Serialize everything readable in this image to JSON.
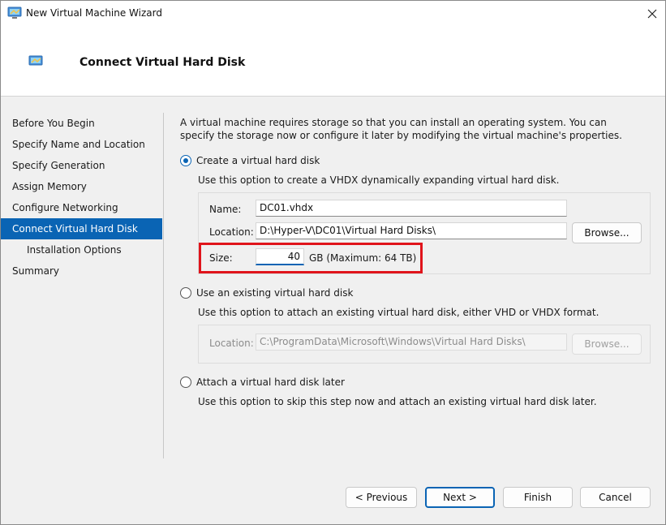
{
  "window": {
    "title": "New Virtual Machine Wizard"
  },
  "header": {
    "page_title": "Connect Virtual Hard Disk"
  },
  "sidebar": {
    "items": [
      {
        "label": "Before You Begin"
      },
      {
        "label": "Specify Name and Location"
      },
      {
        "label": "Specify Generation"
      },
      {
        "label": "Assign Memory"
      },
      {
        "label": "Configure Networking"
      },
      {
        "label": "Connect Virtual Hard Disk",
        "active": true
      },
      {
        "label": "Installation Options"
      },
      {
        "label": "Summary"
      }
    ]
  },
  "main": {
    "intro": "A virtual machine requires storage so that you can install an operating system. You can specify the storage now or configure it later by modifying the virtual machine's properties.",
    "create_option": {
      "label": "Create a virtual hard disk",
      "selected": true,
      "description": "Use this option to create a VHDX dynamically expanding virtual hard disk.",
      "name_label": "Name:",
      "name_value": "DC01.vhdx",
      "location_label": "Location:",
      "location_value": "D:\\Hyper-V\\DC01\\Virtual Hard Disks\\",
      "browse_label": "Browse...",
      "size_label": "Size:",
      "size_value": "40",
      "size_unit": "GB (Maximum: 64 TB)"
    },
    "existing_option": {
      "label": "Use an existing virtual hard disk",
      "selected": false,
      "description": "Use this option to attach an existing virtual hard disk, either VHD or VHDX format.",
      "location_label": "Location:",
      "location_value": "C:\\ProgramData\\Microsoft\\Windows\\Virtual Hard Disks\\",
      "browse_label": "Browse..."
    },
    "later_option": {
      "label": "Attach a virtual hard disk later",
      "selected": false,
      "description": "Use this option to skip this step now and attach an existing virtual hard disk later."
    }
  },
  "footer": {
    "previous_label": "< Previous",
    "next_label": "Next >",
    "finish_label": "Finish",
    "cancel_label": "Cancel"
  },
  "colors": {
    "accent": "#0a64b4",
    "highlight": "#e0141b"
  }
}
